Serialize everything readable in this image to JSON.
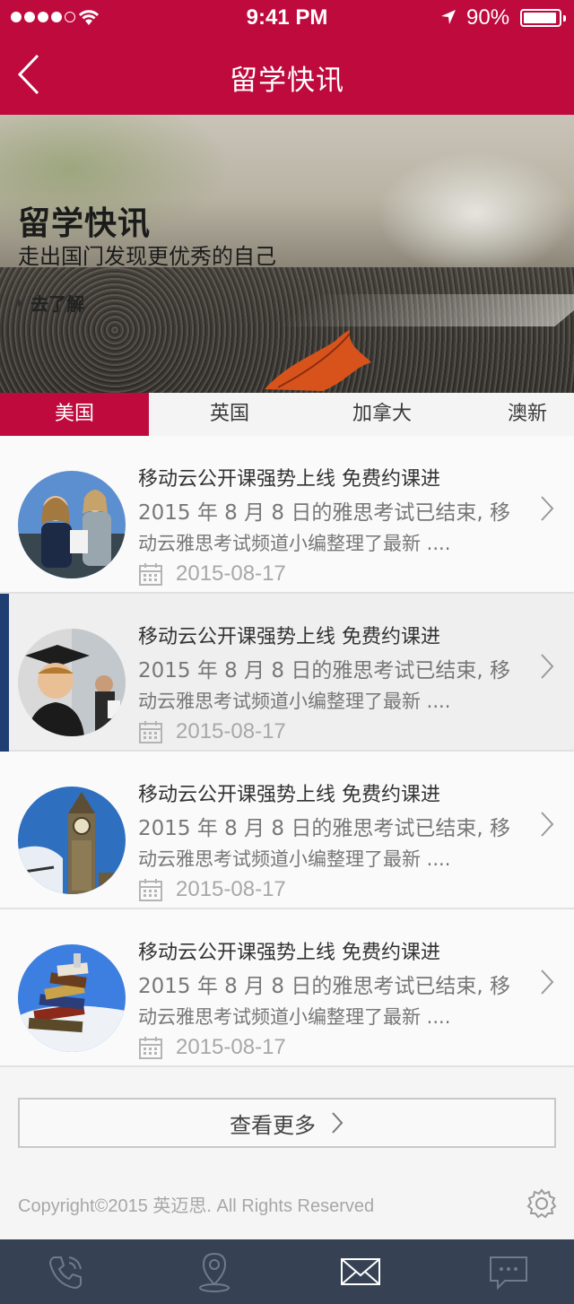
{
  "status": {
    "time": "9:41 PM",
    "battery": "90%"
  },
  "nav": {
    "title": "留学快讯"
  },
  "hero": {
    "title": "留学快讯",
    "subtitle": "走出国门发现更优秀的自己",
    "link": "去了解"
  },
  "tabs": [
    "美国",
    "英国",
    "加拿大",
    "澳新"
  ],
  "articles": [
    {
      "title": "移动云公开课强势上线 免费约课进",
      "desc1": "2015 年 8 月 8 日的雅思考试已结束, 移",
      "desc2": "动云雅思考试频道小编整理了最新 ....",
      "date": "2015-08-17"
    },
    {
      "title": "移动云公开课强势上线 免费约课进",
      "desc1": "2015 年 8 月 8 日的雅思考试已结束, 移",
      "desc2": "动云雅思考试频道小编整理了最新 ....",
      "date": "2015-08-17"
    },
    {
      "title": "移动云公开课强势上线 免费约课进",
      "desc1": "2015 年 8 月 8 日的雅思考试已结束, 移",
      "desc2": "动云雅思考试频道小编整理了最新 ....",
      "date": "2015-08-17"
    },
    {
      "title": "移动云公开课强势上线 免费约课进",
      "desc1": "2015 年 8 月 8 日的雅思考试已结束, 移",
      "desc2": "动云雅思考试频道小编整理了最新 ....",
      "date": "2015-08-17"
    }
  ],
  "more_label": "查看更多",
  "copyright": "Copyright©2015 英迈思. All Rights Reserved",
  "icons": {
    "status": [
      "signal-dots-icon",
      "wifi-icon",
      "location-arrow-icon",
      "battery-icon"
    ],
    "nav": "back-chevron-icon",
    "list": [
      "calendar-icon",
      "chevron-right-icon"
    ],
    "bottom": [
      "phone-icon",
      "map-pin-icon",
      "mail-icon",
      "chat-icon"
    ],
    "settings": "gear-icon"
  },
  "colors": {
    "brand": "#be0a3d",
    "bottom_bar": "#364254",
    "selected_marker": "#1f3f72"
  }
}
